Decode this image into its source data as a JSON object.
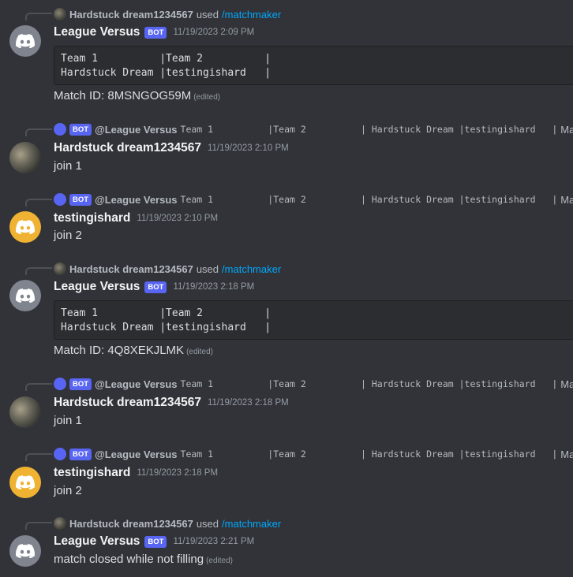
{
  "bot_tag": "BOT",
  "command_reply": {
    "user": "Hardstuck dream1234567",
    "used_text": "used",
    "command": "/matchmaker"
  },
  "bot_reply": {
    "mention": "@League Versus",
    "code": "Team 1          |Team 2          | Hardstuck Dream |testingishard   |",
    "trail": "Match ID"
  },
  "messages": [
    {
      "author": "League Versus",
      "timestamp": "11/19/2023 2:09 PM",
      "code_lines": [
        "Team 1          |Team 2          |",
        "Hardstuck Dream |testingishard   |"
      ],
      "text": "Match ID: 8MSNGOG59M",
      "edited": "(edited)"
    },
    {
      "author": "Hardstuck dream1234567",
      "timestamp": "11/19/2023 2:10 PM",
      "text": "join 1"
    },
    {
      "author": "testingishard",
      "timestamp": "11/19/2023 2:10 PM",
      "text": "join 2"
    },
    {
      "author": "League Versus",
      "timestamp": "11/19/2023 2:18 PM",
      "code_lines": [
        "Team 1          |Team 2          |",
        "Hardstuck Dream |testingishard   |"
      ],
      "text": "Match ID: 4Q8XEKJLMK",
      "edited": "(edited)"
    },
    {
      "author": "Hardstuck dream1234567",
      "timestamp": "11/19/2023 2:18 PM",
      "text": "join 1"
    },
    {
      "author": "testingishard",
      "timestamp": "11/19/2023 2:18 PM",
      "text": "join 2"
    },
    {
      "author": "League Versus",
      "timestamp": "11/19/2023 2:21 PM",
      "text": "match closed while not filling",
      "edited": "(edited)"
    }
  ],
  "colors": {
    "background": "#313338",
    "bot_tag": "#5865f2",
    "command_link": "#00a8fc",
    "bot_avatar": "#80848e",
    "orange_avatar": "#f0b232"
  }
}
